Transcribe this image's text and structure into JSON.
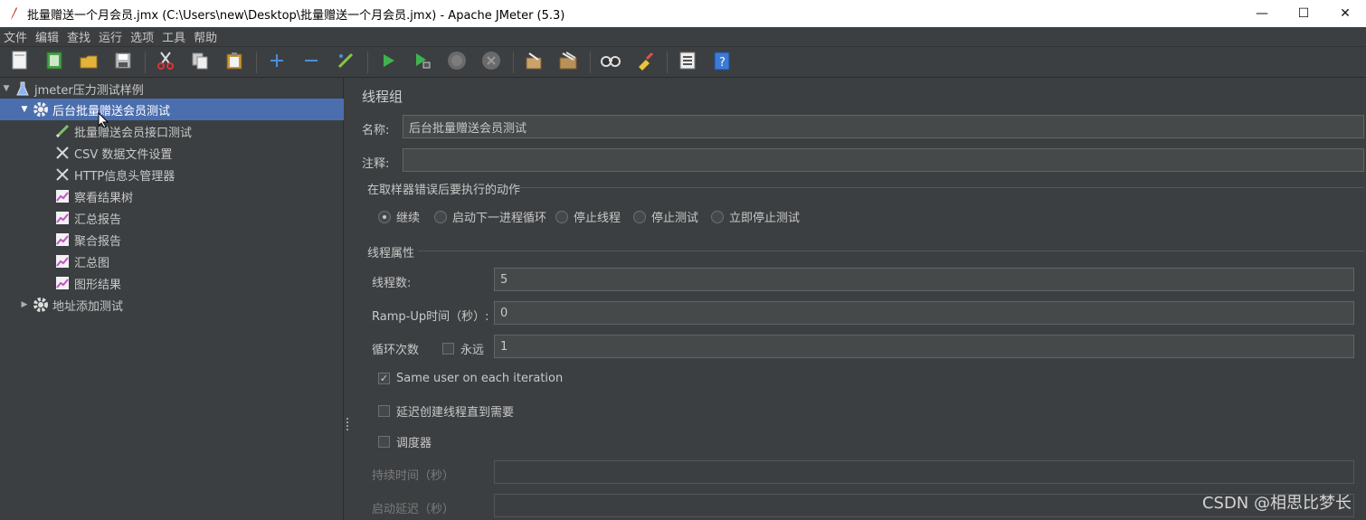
{
  "window": {
    "title": "批量赠送一个月会员.jmx (C:\\Users\\new\\Desktop\\批量赠送一个月会员.jmx) - Apache JMeter (5.3)",
    "minimize": "—",
    "maximize": "☐",
    "close": "✕"
  },
  "menu": [
    "文件",
    "编辑",
    "查找",
    "运行",
    "选项",
    "工具",
    "帮助"
  ],
  "toolbar": [
    {
      "name": "new-icon",
      "color": "#f3f3f3"
    },
    {
      "name": "templates-icon",
      "color": "#4aa04a"
    },
    {
      "name": "open-icon",
      "color": "#e2b23a"
    },
    {
      "name": "save-icon",
      "color": "#cfcfcf"
    },
    {
      "name": "cut-icon",
      "color": "#d33"
    },
    {
      "name": "copy-icon",
      "color": "#ccc"
    },
    {
      "name": "paste-icon",
      "color": "#e2b23a"
    },
    {
      "name": "expand-icon",
      "color": "#4b8fd8"
    },
    {
      "name": "collapse-icon",
      "color": "#4b8fd8"
    },
    {
      "name": "toggle-icon",
      "color": "#8bc34a"
    },
    {
      "name": "start-icon",
      "color": "#3fb34f"
    },
    {
      "name": "start-no-pause-icon",
      "color": "#3fb34f"
    },
    {
      "name": "stop-icon",
      "color": "#777"
    },
    {
      "name": "shutdown-icon",
      "color": "#777"
    },
    {
      "name": "clear-icon",
      "color": "#c9a46a"
    },
    {
      "name": "clear-all-icon",
      "color": "#c9a46a"
    },
    {
      "name": "search-icon",
      "color": "#ddd"
    },
    {
      "name": "reset-search-icon",
      "color": "#f0c23a"
    },
    {
      "name": "function-helper-icon",
      "color": "#eee"
    },
    {
      "name": "help-icon",
      "color": "#3d7ad6"
    }
  ],
  "tree": {
    "root": "jmeter压力测试样例",
    "thread_group": "后台批量赠送会员测试",
    "children": [
      {
        "label": "批量赠送会员接口测试",
        "icon": "sampler-icon"
      },
      {
        "label": "CSV 数据文件设置",
        "icon": "config-icon"
      },
      {
        "label": "HTTP信息头管理器",
        "icon": "config-icon"
      },
      {
        "label": "察看结果树",
        "icon": "listener-icon"
      },
      {
        "label": "汇总报告",
        "icon": "listener-icon"
      },
      {
        "label": "聚合报告",
        "icon": "listener-icon"
      },
      {
        "label": "汇总图",
        "icon": "listener-icon"
      },
      {
        "label": "图形结果",
        "icon": "listener-icon"
      }
    ],
    "second_group": "地址添加测试"
  },
  "panel": {
    "heading": "线程组",
    "name_label": "名称:",
    "name_value": "后台批量赠送会员测试",
    "comment_label": "注释:",
    "comment_value": "",
    "error_group_title": "在取样器错误后要执行的动作",
    "error_actions": [
      "继续",
      "启动下一进程循环",
      "停止线程",
      "停止测试",
      "立即停止测试"
    ],
    "error_selected": 0,
    "props_title": "线程属性",
    "threads_label": "线程数:",
    "threads_value": "5",
    "rampup_label": "Ramp-Up时间（秒）:",
    "rampup_value": "0",
    "loop_label": "循环次数",
    "forever_label": "永远",
    "forever_checked": false,
    "loop_value": "1",
    "same_user_label": "Same user on each iteration",
    "same_user_checked": true,
    "delay_label": "延迟创建线程直到需要",
    "delay_checked": false,
    "scheduler_label": "调度器",
    "scheduler_checked": false,
    "duration_label": "持续时间（秒）",
    "startup_delay_label": "启动延迟（秒）"
  },
  "watermark": "CSDN @相思比梦长"
}
